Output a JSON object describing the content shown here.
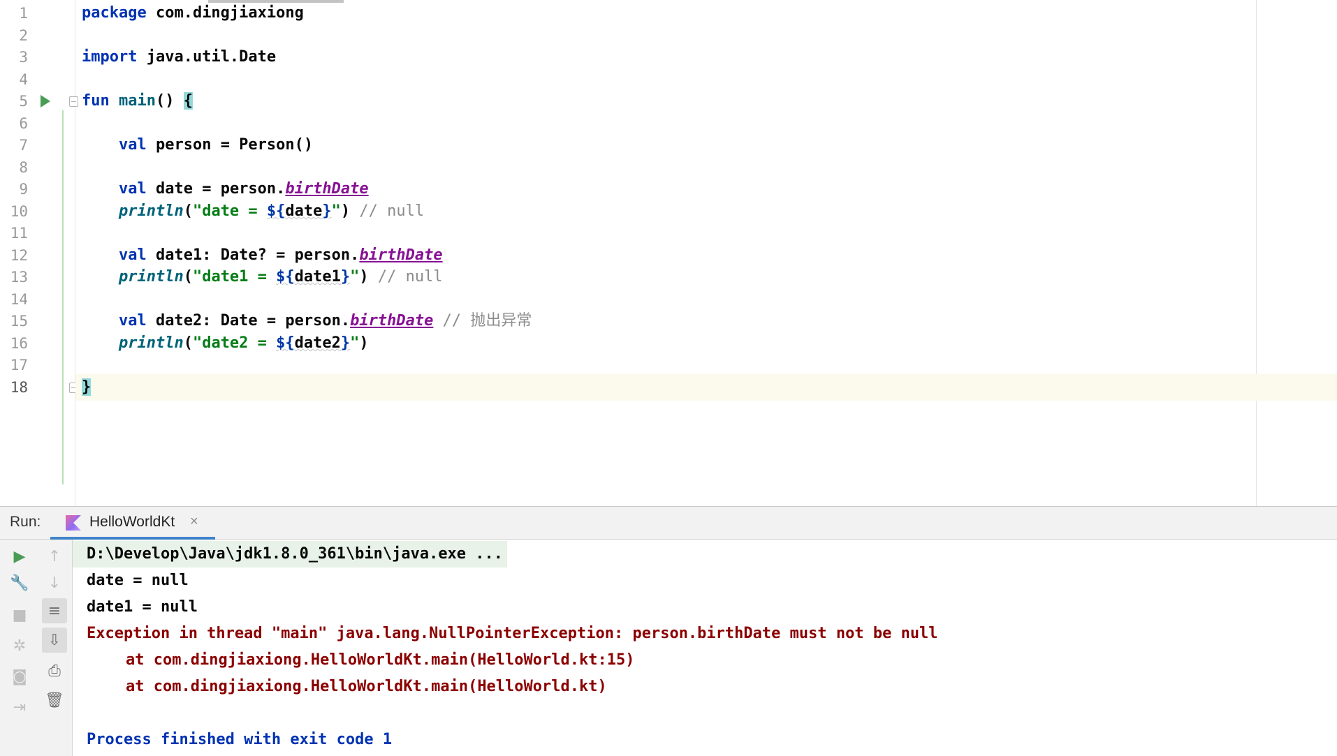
{
  "editor": {
    "lines": [
      {
        "num": "1"
      },
      {
        "num": "2"
      },
      {
        "num": "3"
      },
      {
        "num": "4"
      },
      {
        "num": "5"
      },
      {
        "num": "6"
      },
      {
        "num": "7"
      },
      {
        "num": "8"
      },
      {
        "num": "9"
      },
      {
        "num": "10"
      },
      {
        "num": "11"
      },
      {
        "num": "12"
      },
      {
        "num": "13"
      },
      {
        "num": "14"
      },
      {
        "num": "15"
      },
      {
        "num": "16"
      },
      {
        "num": "17"
      },
      {
        "num": "18"
      }
    ],
    "code": {
      "l1": {
        "kw": "package",
        "rest": " com.dingjiaxiong"
      },
      "l3": {
        "kw": "import",
        "rest": " java.util.Date"
      },
      "l5": {
        "kw": "fun",
        "fn": " main",
        "paren": "() ",
        "brace": "{"
      },
      "l7": {
        "indent": "    ",
        "kw": "val",
        "rest": " person = Person()"
      },
      "l9": {
        "indent": "    ",
        "kw": "val",
        "rest": " date = person.",
        "prop": "birthDate"
      },
      "l10": {
        "indent": "    ",
        "call": "println",
        "open": "(",
        "str1": "\"date = ",
        "tmpl_open": "${",
        "var": "date",
        "tmpl_close": "}",
        "str2": "\"",
        "close": ") ",
        "comment": "// null"
      },
      "l12": {
        "indent": "    ",
        "kw": "val",
        "rest": " date1: Date? = person.",
        "prop": "birthDate"
      },
      "l13": {
        "indent": "    ",
        "call": "println",
        "open": "(",
        "str1": "\"date1 = ",
        "tmpl_open": "${",
        "var": "date1",
        "tmpl_close": "}",
        "str2": "\"",
        "close": ") ",
        "comment": "// null"
      },
      "l15": {
        "indent": "    ",
        "kw": "val",
        "rest": " date2: Date = person.",
        "prop": "birthDate",
        "comment": " // 抛出异常"
      },
      "l16": {
        "indent": "    ",
        "call": "println",
        "open": "(",
        "str1": "\"date2 = ",
        "tmpl_open": "${",
        "var": "date2",
        "tmpl_close": "}",
        "str2": "\"",
        "close": ")"
      },
      "l18": {
        "brace": "}"
      }
    }
  },
  "run_window": {
    "title": "Run:",
    "tab_label": "HelloWorldKt",
    "tab_close": "×",
    "toolbar": {
      "rerun": "▶",
      "up": "↑",
      "down": "↓",
      "wrench": "🔧",
      "soft_wrap": "≡",
      "stop": "■",
      "scroll_end": "⇩",
      "debug": "✲",
      "print": "⎙",
      "camera": "◙",
      "trash": "🗑",
      "exit": "⇥"
    },
    "console": [
      {
        "type": "cmd",
        "text": "D:\\Develop\\Java\\jdk1.8.0_361\\bin\\java.exe ..."
      },
      {
        "type": "out",
        "text": "date = null"
      },
      {
        "type": "out",
        "text": "date1 = null"
      },
      {
        "type": "err",
        "text": "Exception in thread \"main\" java.lang.NullPointerException: person.birthDate must not be null"
      },
      {
        "type": "trace",
        "text": "at com.dingjiaxiong.HelloWorldKt.main(HelloWorld.kt:15)"
      },
      {
        "type": "trace",
        "text": "at com.dingjiaxiong.HelloWorldKt.main(HelloWorld.kt)"
      },
      {
        "type": "exit",
        "text": "Process finished with exit code 1"
      }
    ]
  },
  "colors": {
    "keyword": "#0033b3",
    "string": "#067d17",
    "property": "#871094",
    "error": "#8b0000",
    "run_green": "#499c54",
    "tab_underline": "#4083c9"
  }
}
